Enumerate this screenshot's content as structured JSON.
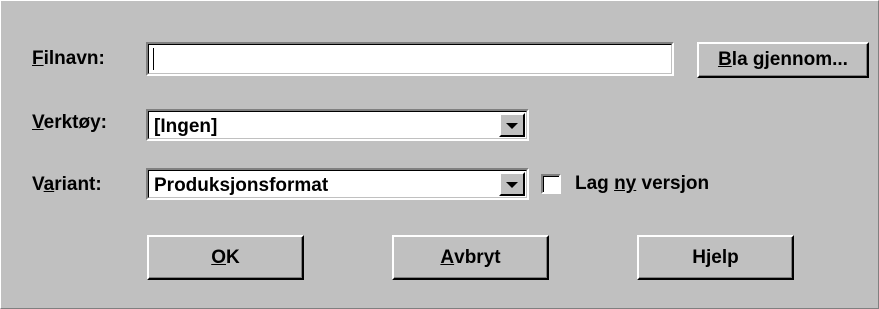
{
  "filename": {
    "label_accel": "F",
    "label_rest": "ilnavn:",
    "value": ""
  },
  "browse_button": {
    "accel": "B",
    "rest": "la gjennom..."
  },
  "tool": {
    "label_accel": "V",
    "label_rest": "erktøy:",
    "selected": "[Ingen]"
  },
  "variant": {
    "label_pre": "V",
    "label_accel": "a",
    "label_rest": "riant:",
    "selected": "Produksjonsformat"
  },
  "new_version": {
    "label_pre": "Lag ",
    "label_accel": "ny",
    "label_rest": " versjon",
    "checked": false
  },
  "buttons": {
    "ok": {
      "accel": "O",
      "rest": "K"
    },
    "cancel": {
      "accel": "A",
      "rest": "vbryt"
    },
    "help": {
      "label": "Hjelp"
    }
  }
}
